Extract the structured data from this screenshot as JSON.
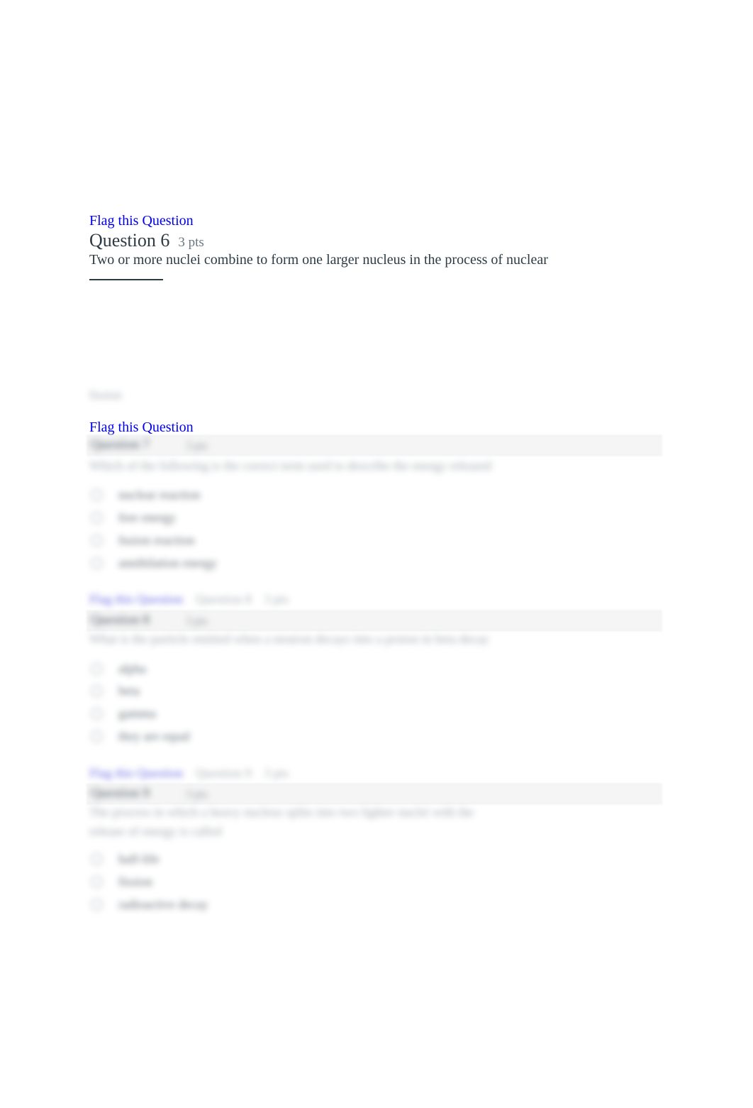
{
  "page": {
    "background_color": "#ffffff",
    "link_color": "#0000ee",
    "text_color": "#2d3b45",
    "muted_text_color": "#6b7780",
    "bar_background": "#f5f5f5"
  },
  "question_6": {
    "flag_label": "Flag this Question",
    "title": "Question 6",
    "points": "3 pts",
    "body_text": "Two or more nuclei combine to form one larger nucleus in the process of nuclear",
    "blank_underline": true
  },
  "obscured_remnant": {
    "text": "fission"
  },
  "flag_link_2": {
    "label": "Flag this Question"
  },
  "question_7": {
    "title": "Question 7",
    "points": "3 pts",
    "body_text": "Which of the following is the correct term used to describe the energy released",
    "options": [
      {
        "label": "nuclear reaction"
      },
      {
        "label": "free energy"
      },
      {
        "label": "fusion reaction"
      },
      {
        "label": "annihilation energy"
      }
    ],
    "links": [
      "Flag this Question",
      "Question 8",
      "3 pts"
    ]
  },
  "question_8": {
    "title": "Question 8",
    "points": "3 pts",
    "body_text": "What is the particle emitted when a neutron decays into a proton in beta decay",
    "options": [
      {
        "label": "alpha"
      },
      {
        "label": "beta"
      },
      {
        "label": "gamma"
      },
      {
        "label": "they are equal"
      }
    ],
    "links": [
      "Flag this Question",
      "Question 9",
      "3 pts"
    ]
  },
  "question_9": {
    "title": "Question 9",
    "points": "3 pts",
    "body_line_1": "The process in which a heavy nucleus splits into two lighter nuclei with the",
    "body_line_2": "release of energy is called",
    "options": [
      {
        "label": "half-life"
      },
      {
        "label": "fission"
      },
      {
        "label": "radioactive decay"
      }
    ]
  }
}
